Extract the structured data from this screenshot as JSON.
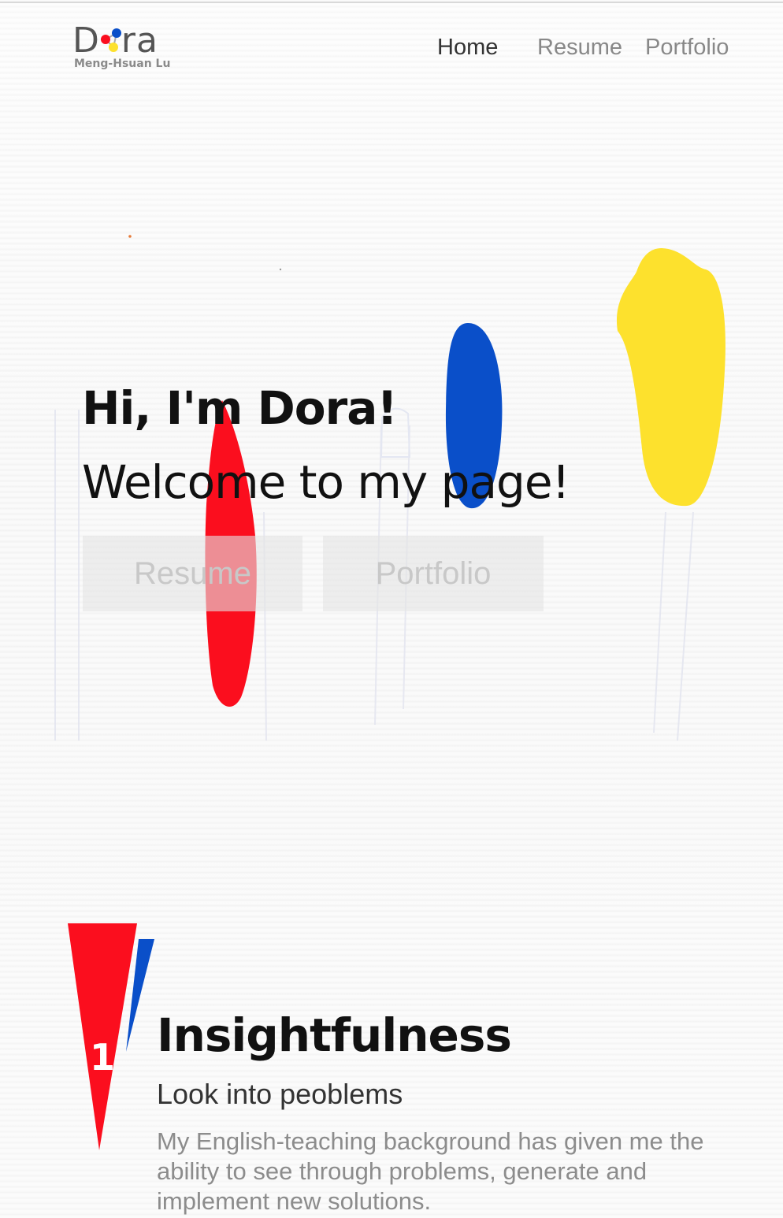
{
  "logo": {
    "word_start": "D",
    "word_end": "ra",
    "subtitle": "Meng-Hsuan Lu"
  },
  "nav": {
    "items": [
      {
        "label": "Home",
        "active": true
      },
      {
        "label": "Resume",
        "active": false
      },
      {
        "label": "Portfolio",
        "active": false
      }
    ]
  },
  "hero": {
    "title": "Hi, I'm Dora!",
    "subtitle": "Welcome to my page!",
    "buttons": [
      {
        "label": "Resume"
      },
      {
        "label": "Portfolio"
      }
    ]
  },
  "section": {
    "number": "1",
    "title": "Insightfulness",
    "subtitle": "Look into peoblems",
    "body": "My English-teaching background has given me the ability to see through problems, generate and implement new solutions."
  },
  "colors": {
    "red": "#fb0e1e",
    "blue": "#0a4fc9",
    "yellow": "#fde12d",
    "nav_active": "#333333",
    "nav_inactive": "#888888"
  }
}
